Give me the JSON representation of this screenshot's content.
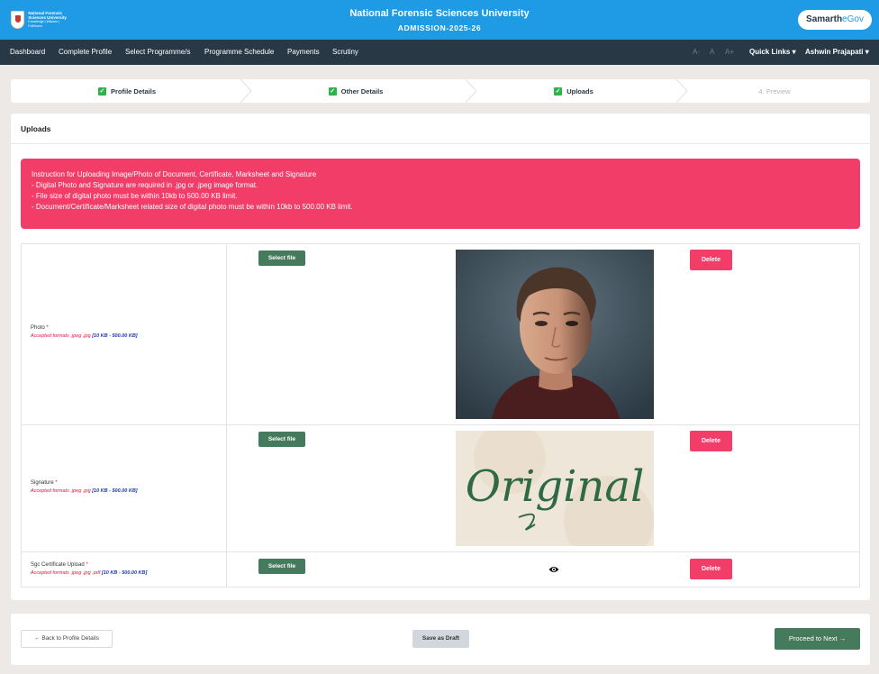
{
  "header": {
    "logo_lines": [
      "National Forensic",
      "Sciences University",
      "Knowledge | Wisdom | Fulfilment"
    ],
    "university_name": "National Forensic Sciences University",
    "admission_label": "ADMISSION-2025-26",
    "brand_primary": "Samarth",
    "brand_secondary": "eGov",
    "header_color": "#1e9be4"
  },
  "nav": {
    "items": [
      "Dashboard",
      "Complete Profile",
      "Select Programme/s",
      "Programme Schedule",
      "Payments",
      "Scrutiny"
    ],
    "font_small": "A-",
    "font_normal": "A",
    "font_large": "A+",
    "quick_links": "Quick Links",
    "user_name": "Ashwin Prajapati",
    "nav_color": "#283845"
  },
  "stepper": {
    "steps": [
      {
        "label": "Profile Details",
        "status": "completed"
      },
      {
        "label": "Other Details",
        "status": "completed"
      },
      {
        "label": "Uploads",
        "status": "completed"
      },
      {
        "label": "4. Preview",
        "status": "pending"
      }
    ],
    "check_color": "#2db34a"
  },
  "uploads": {
    "title": "Uploads",
    "instructions": [
      "Instruction for Uploading Image/Photo of Document, Certificate, Marksheet and Signature",
      "- Digital Photo and Signature are required in .jpg or .jpeg image format.",
      "- File size of digital photo must be within 10kb to 500.00 KB limit.",
      "- Document/Certificate/Marksheet related size of digital photo must be within 10kb to 500.00 KB limit."
    ],
    "alert_color": "#f23d69",
    "rows": [
      {
        "label": "Photo",
        "required_mark": "*",
        "formats": "Accepted formats .jpeg .jpg",
        "size_limit": "[10 KB - 500.00 KB]",
        "select_label": "Select file",
        "delete_label": "Delete",
        "preview": "photo"
      },
      {
        "label": "Signature",
        "required_mark": "*",
        "formats": "Accepted formats .jpeg .jpg",
        "size_limit": "[10 KB - 500.00 KB]",
        "select_label": "Select file",
        "delete_label": "Delete",
        "preview": "signature",
        "signature_text": "Original"
      },
      {
        "label": "Sgc Certificate Upload",
        "required_mark": "*",
        "formats": "Accepted formats .jpeg .jpg .pdf",
        "size_limit": "[10 KB - 500.00 KB]",
        "select_label": "Select file",
        "delete_label": "Delete",
        "preview": "eye-icon"
      }
    ]
  },
  "footer": {
    "back_label": "← Back to Profile Details",
    "draft_label": "Save as Draft",
    "next_label": "Proceed to Next →",
    "next_color": "#467a5c"
  }
}
